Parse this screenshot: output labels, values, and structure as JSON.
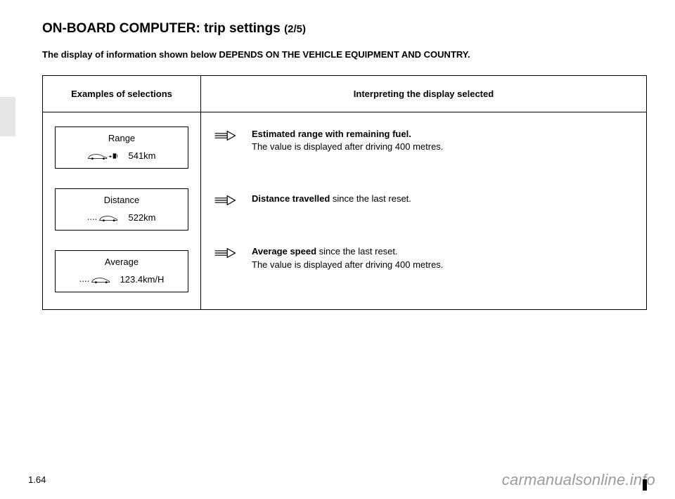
{
  "title": {
    "main": "ON-BOARD COMPUTER: trip settings ",
    "sub": "(2/5)"
  },
  "notice": "The display of information shown below DEPENDS ON THE VEHICLE EQUIPMENT AND COUNTRY.",
  "table": {
    "header_left": "Examples of selections",
    "header_right": "Interpreting the display selected"
  },
  "rows": [
    {
      "label": "Range",
      "value": "541km",
      "icon": "car-fuel",
      "interp_bold": "Estimated range with remaining fuel.",
      "interp_rest": "The value is displayed after driving 400 metres."
    },
    {
      "label": "Distance",
      "value": "522km",
      "icon": "car-dots",
      "interp_bold": "Distance travelled",
      "interp_rest_inline": " since the last reset.",
      "interp_rest": ""
    },
    {
      "label": "Average",
      "value": "123.4km/H",
      "icon": "car-dots",
      "interp_bold": "Average speed",
      "interp_rest_inline": " since the last reset.",
      "interp_rest": "The value is displayed after driving 400 metres."
    }
  ],
  "page_number": "1.64",
  "watermark": "carmanualsonline.info"
}
